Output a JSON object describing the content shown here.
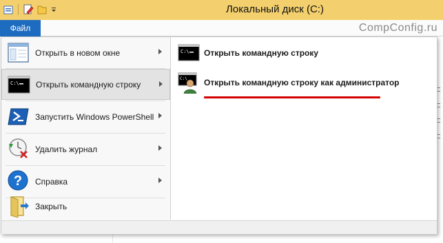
{
  "window": {
    "title": "Локальный диск (C:)",
    "watermark": "CompConfig.ru"
  },
  "ribbon": {
    "file_tab": "Файл"
  },
  "menu": {
    "items": [
      {
        "label": "Открыть в новом окне",
        "icon": "new-window-icon",
        "has_submenu": true,
        "selected": false
      },
      {
        "label": "Открыть командную строку",
        "icon": "command-prompt-icon",
        "has_submenu": true,
        "selected": true
      },
      {
        "label": "Запустить Windows PowerShell",
        "icon": "powershell-icon",
        "has_submenu": true,
        "selected": false
      },
      {
        "label": "Удалить журнал",
        "icon": "delete-history-icon",
        "has_submenu": true,
        "selected": false
      },
      {
        "label": "Справка",
        "icon": "help-icon",
        "has_submenu": true,
        "selected": false
      },
      {
        "label": "Закрыть",
        "icon": "close-folder-icon",
        "has_submenu": false,
        "selected": false
      }
    ]
  },
  "submenu": {
    "items": [
      {
        "label": "Открыть командную строку",
        "icon": "command-prompt-icon"
      },
      {
        "label": "Открыть командную строку как администратор",
        "icon": "admin-command-prompt-icon"
      }
    ]
  },
  "colors": {
    "title_bar": "#f3d06d",
    "file_tab": "#1e6cc0",
    "annotation_underline": "#d40000"
  }
}
